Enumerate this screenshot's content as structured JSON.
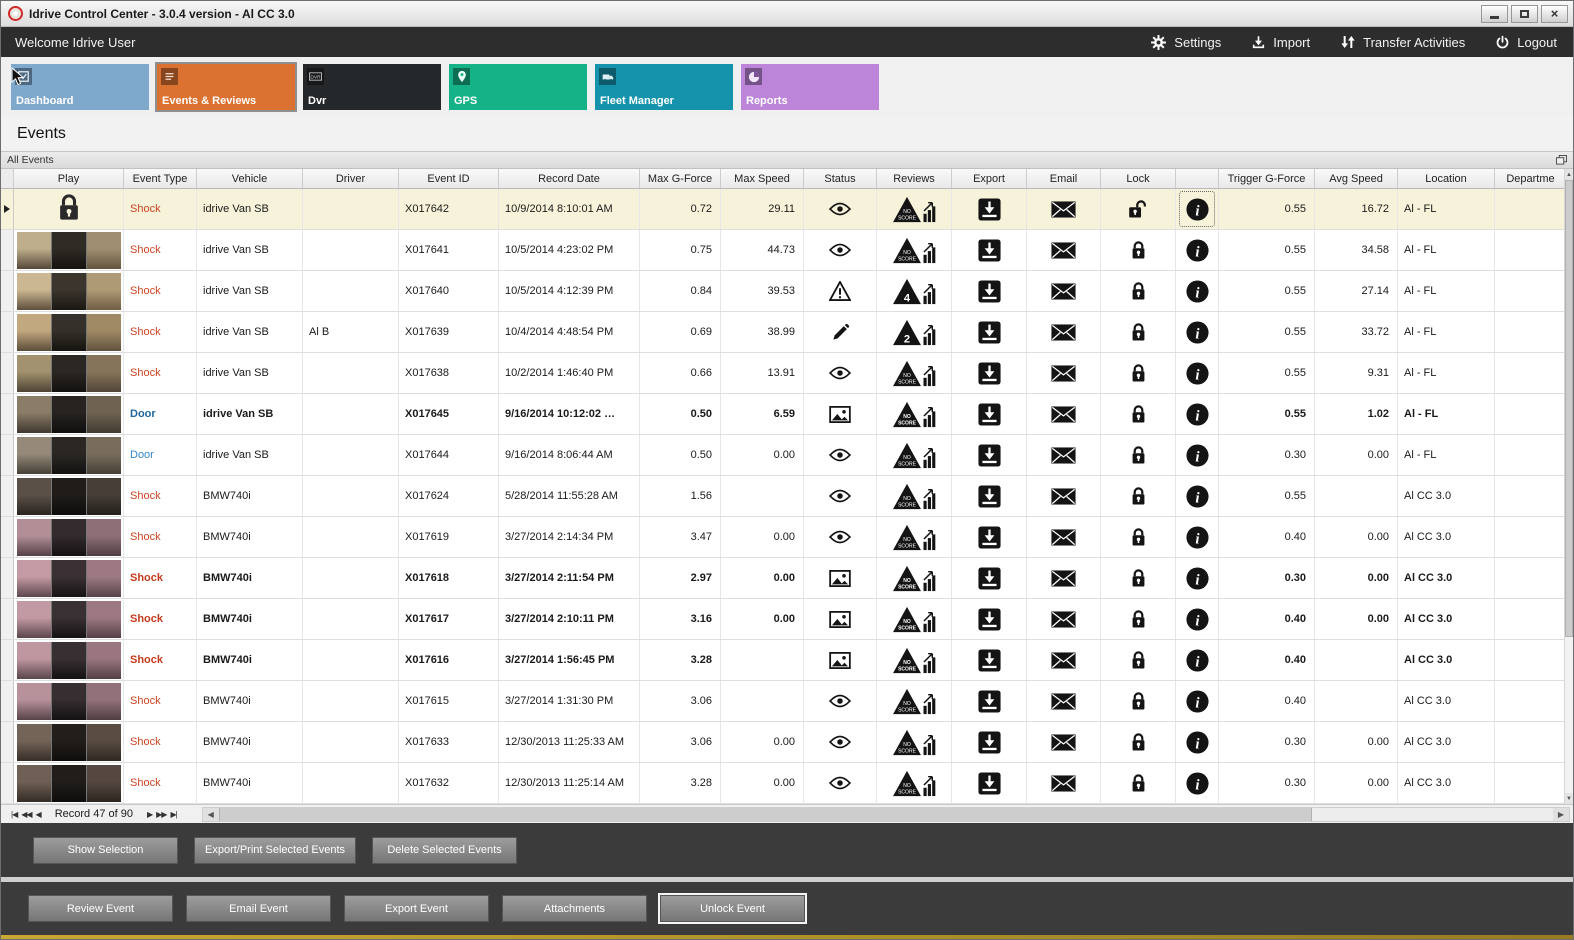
{
  "window": {
    "title": "Idrive Control Center - 3.0.4 version - Al CC 3.0"
  },
  "topbar": {
    "welcome": "Welcome Idrive User",
    "actions": [
      {
        "id": "settings",
        "label": "Settings"
      },
      {
        "id": "import",
        "label": "Import"
      },
      {
        "id": "transfer",
        "label": "Transfer Activities"
      },
      {
        "id": "logout",
        "label": "Logout"
      }
    ]
  },
  "nav": {
    "tiles": [
      {
        "id": "dashboard",
        "label": "Dashboard",
        "color": "#7fa8cd",
        "selected": false
      },
      {
        "id": "events",
        "label": "Events & Reviews",
        "color": "#dc7231",
        "selected": true
      },
      {
        "id": "dvr",
        "label": "Dvr",
        "color": "#24282a",
        "selected": false
      },
      {
        "id": "gps",
        "label": "GPS",
        "color": "#16b287",
        "selected": false
      },
      {
        "id": "fleet",
        "label": "Fleet Manager",
        "color": "#1593ac",
        "selected": false
      },
      {
        "id": "reports",
        "label": "Reports",
        "color": "#bd85da",
        "selected": false
      }
    ]
  },
  "page": {
    "title": "Events",
    "group": "All Events"
  },
  "table": {
    "columns": [
      "Play",
      "Event Type",
      "Vehicle",
      "Driver",
      "Event ID",
      "Record Date",
      "Max G-Force",
      "Max Speed",
      "Status",
      "Reviews",
      "Export",
      "Email",
      "Lock",
      "",
      "Trigger G-Force",
      "Avg Speed",
      "Location",
      "Departme"
    ],
    "rows": [
      {
        "selected": true,
        "bold": false,
        "play": "lock",
        "thumb": [],
        "event_type": "Shock",
        "type_color": "#cc4423",
        "vehicle": "idrive Van SB",
        "driver": "",
        "event_id": "X017642",
        "record_date": "10/9/2014 8:10:01 AM",
        "max_g": "0.72",
        "max_speed": "29.11",
        "status": "eye",
        "score": "NO SCORE",
        "lock": "unlocked",
        "info_focused": true,
        "trigger_g": "0.55",
        "avg_speed": "16.72",
        "location": "Al - FL"
      },
      {
        "selected": false,
        "bold": false,
        "play": "thumb",
        "thumb": [
          "#bfae8c #55483a",
          "#2f2b25 #15120f",
          "#9f8e6f #635440"
        ],
        "event_type": "Shock",
        "type_color": "#cc4423",
        "vehicle": "idrive Van SB",
        "driver": "",
        "event_id": "X017641",
        "record_date": "10/5/2014 4:23:02 PM",
        "max_g": "0.75",
        "max_speed": "44.73",
        "status": "eye",
        "score": "NO SCORE",
        "lock": "locked",
        "info_focused": false,
        "trigger_g": "0.55",
        "avg_speed": "34.58",
        "location": "Al - FL"
      },
      {
        "selected": false,
        "bold": false,
        "play": "thumb",
        "thumb": [
          "#cbb892 #60503e",
          "#3b352d #1a1713",
          "#ae9b76 #6e5c45"
        ],
        "event_type": "Shock",
        "type_color": "#cc4423",
        "vehicle": "idrive Van SB",
        "driver": "",
        "event_id": "X017640",
        "record_date": "10/5/2014 4:12:39 PM",
        "max_g": "0.84",
        "max_speed": "39.53",
        "status": "warning",
        "score": "4",
        "lock": "locked",
        "info_focused": false,
        "trigger_g": "0.55",
        "avg_speed": "27.14",
        "location": "Al - FL"
      },
      {
        "selected": false,
        "bold": false,
        "play": "thumb",
        "thumb": [
          "#c2a87e #5c4c3a",
          "#35302a #161310",
          "#a08a65 #60513d"
        ],
        "event_type": "Shock",
        "type_color": "#cc4423",
        "vehicle": "idrive Van SB",
        "driver": "Al B",
        "event_id": "X017639",
        "record_date": "10/4/2014 4:48:54 PM",
        "max_g": "0.69",
        "max_speed": "38.99",
        "status": "edit",
        "score": "2",
        "lock": "locked",
        "info_focused": false,
        "trigger_g": "0.55",
        "avg_speed": "33.72",
        "location": "Al - FL"
      },
      {
        "selected": false,
        "bold": false,
        "play": "thumb",
        "thumb": [
          "#a3926f #4e4335",
          "#2b2722 #131110",
          "#857459 #514538"
        ],
        "event_type": "Shock",
        "type_color": "#cc4423",
        "vehicle": "idrive Van SB",
        "driver": "",
        "event_id": "X017638",
        "record_date": "10/2/2014 1:46:40 PM",
        "max_g": "0.66",
        "max_speed": "13.91",
        "status": "eye",
        "score": "NO SCORE",
        "lock": "locked",
        "info_focused": false,
        "trigger_g": "0.55",
        "avg_speed": "9.31",
        "location": "Al - FL"
      },
      {
        "selected": false,
        "bold": true,
        "play": "thumb",
        "thumb": [
          "#8a7c66 #3f382f",
          "#262320 #100f0d",
          "#6e6250 #423a30"
        ],
        "event_type": "Door",
        "type_color": "#20689b",
        "vehicle": "idrive Van SB",
        "driver": "",
        "event_id": "X017645",
        "record_date": "9/16/2014 10:12:02 …",
        "max_g": "0.50",
        "max_speed": "6.59",
        "status": "photo",
        "score": "NO SCORE",
        "lock": "locked",
        "info_focused": false,
        "trigger_g": "0.55",
        "avg_speed": "1.02",
        "location": "Al - FL"
      },
      {
        "selected": false,
        "bold": false,
        "play": "thumb",
        "thumb": [
          "#958a7a #453f36",
          "#2b2824 #121110",
          "#786d5d #473f35"
        ],
        "event_type": "Door",
        "type_color": "#2f86c8",
        "vehicle": "idrive Van SB",
        "driver": "",
        "event_id": "X017644",
        "record_date": "9/16/2014 8:06:44 AM",
        "max_g": "0.50",
        "max_speed": "0.00",
        "status": "eye",
        "score": "NO SCORE",
        "lock": "locked",
        "info_focused": false,
        "trigger_g": "0.30",
        "avg_speed": "0.00",
        "location": "Al - FL"
      },
      {
        "selected": false,
        "bold": false,
        "play": "thumb",
        "thumb": [
          "#5a5048 #2a2521",
          "#1f1c19 #0e0d0c",
          "#463e37 #231f1b"
        ],
        "event_type": "Shock",
        "type_color": "#cc4423",
        "vehicle": "BMW740i",
        "driver": "",
        "event_id": "X017624",
        "record_date": "5/28/2014 11:55:28 AM",
        "max_g": "1.56",
        "max_speed": "",
        "status": "eye",
        "score": "NO SCORE",
        "lock": "locked",
        "info_focused": false,
        "trigger_g": "0.55",
        "avg_speed": "",
        "location": "Al CC 3.0"
      },
      {
        "selected": false,
        "bold": false,
        "play": "thumb",
        "thumb": [
          "#b28f97 #554146",
          "#332b2e #151113",
          "#8f6f77 #4e3c41"
        ],
        "event_type": "Shock",
        "type_color": "#cc4423",
        "vehicle": "BMW740i",
        "driver": "",
        "event_id": "X017619",
        "record_date": "3/27/2014 2:14:34 PM",
        "max_g": "3.47",
        "max_speed": "0.00",
        "status": "eye",
        "score": "NO SCORE",
        "lock": "locked",
        "info_focused": false,
        "trigger_g": "0.40",
        "avg_speed": "0.00",
        "location": "Al CC 3.0"
      },
      {
        "selected": false,
        "bold": true,
        "play": "thumb",
        "thumb": [
          "#c49ba4 #5e474d",
          "#3a3033 #171314",
          "#9d7a83 #564147"
        ],
        "event_type": "Shock",
        "type_color": "#c43b1e",
        "vehicle": "BMW740i",
        "driver": "",
        "event_id": "X017618",
        "record_date": "3/27/2014 2:11:54 PM",
        "max_g": "2.97",
        "max_speed": "0.00",
        "status": "photo",
        "score": "NO SCORE",
        "lock": "locked",
        "info_focused": false,
        "trigger_g": "0.30",
        "avg_speed": "0.00",
        "location": "Al CC 3.0"
      },
      {
        "selected": false,
        "bold": true,
        "play": "thumb",
        "thumb": [
          "#c29aa3 #5d464c",
          "#393033 #161314",
          "#9c7982 #554046"
        ],
        "event_type": "Shock",
        "type_color": "#c43b1e",
        "vehicle": "BMW740i",
        "driver": "",
        "event_id": "X017617",
        "record_date": "3/27/2014 2:10:11 PM",
        "max_g": "3.16",
        "max_speed": "0.00",
        "status": "photo",
        "score": "NO SCORE",
        "lock": "locked",
        "info_focused": false,
        "trigger_g": "0.40",
        "avg_speed": "0.00",
        "location": "Al CC 3.0"
      },
      {
        "selected": false,
        "bold": true,
        "play": "thumb",
        "thumb": [
          "#bf97a0 #5b454b",
          "#382f32 #151213",
          "#9a7780 #533f45"
        ],
        "event_type": "Shock",
        "type_color": "#c43b1e",
        "vehicle": "BMW740i",
        "driver": "",
        "event_id": "X017616",
        "record_date": "3/27/2014 1:56:45 PM",
        "max_g": "3.28",
        "max_speed": "",
        "status": "photo",
        "score": "NO SCORE",
        "lock": "locked",
        "info_focused": false,
        "trigger_g": "0.40",
        "avg_speed": "",
        "location": "Al CC 3.0"
      },
      {
        "selected": false,
        "bold": false,
        "play": "thumb",
        "thumb": [
          "#b8929b #584349",
          "#362e31 #141212",
          "#93717a #4f3d42"
        ],
        "event_type": "Shock",
        "type_color": "#cc4423",
        "vehicle": "BMW740i",
        "driver": "",
        "event_id": "X017615",
        "record_date": "3/27/2014 1:31:30 PM",
        "max_g": "3.06",
        "max_speed": "",
        "status": "eye",
        "score": "NO SCORE",
        "lock": "locked",
        "info_focused": false,
        "trigger_g": "0.40",
        "avg_speed": "",
        "location": "Al CC 3.0"
      },
      {
        "selected": false,
        "bold": false,
        "play": "thumb",
        "thumb": [
          "#746357 #362e28",
          "#221e1b #0f0d0c",
          "#594b41 #2e2822"
        ],
        "event_type": "Shock",
        "type_color": "#cc4423",
        "vehicle": "BMW740i",
        "driver": "",
        "event_id": "X017633",
        "record_date": "12/30/2013 11:25:33 AM",
        "max_g": "3.06",
        "max_speed": "0.00",
        "status": "eye",
        "score": "NO SCORE",
        "lock": "locked",
        "info_focused": false,
        "trigger_g": "0.30",
        "avg_speed": "0.00",
        "location": "Al CC 3.0"
      },
      {
        "selected": false,
        "bold": false,
        "play": "thumb",
        "thumb": [
          "#6f5f54 #332c26",
          "#201d1a #0e0d0c",
          "#554840 #2c2620"
        ],
        "event_type": "Shock",
        "type_color": "#cc4423",
        "vehicle": "BMW740i",
        "driver": "",
        "event_id": "X017632",
        "record_date": "12/30/2013 11:25:14 AM",
        "max_g": "3.28",
        "max_speed": "0.00",
        "status": "eye",
        "score": "NO SCORE",
        "lock": "locked",
        "info_focused": false,
        "trigger_g": "0.30",
        "avg_speed": "0.00",
        "location": "Al CC 3.0"
      }
    ]
  },
  "pager": {
    "label": "Record 47 of 90",
    "buttons_left": [
      "|◀",
      "◀◀",
      "◀"
    ],
    "buttons_right": [
      "▶",
      "▶▶",
      "▶|"
    ]
  },
  "selection_actions": [
    {
      "label": "Show Selection"
    },
    {
      "label": "Export/Print Selected Events"
    },
    {
      "label": "Delete Selected Events"
    }
  ],
  "event_actions": [
    {
      "label": "Review Event"
    },
    {
      "label": "Email Event"
    },
    {
      "label": "Export Event"
    },
    {
      "label": "Attachments"
    },
    {
      "label": "Unlock Event",
      "focused": true
    }
  ],
  "colors": {
    "selected_row_bg": "#f6f3da",
    "shock_text": "#cc4423",
    "door_text": "#2f86c8",
    "panel_bg": "#3b3b3b",
    "accent_strip": "#b5952c"
  }
}
